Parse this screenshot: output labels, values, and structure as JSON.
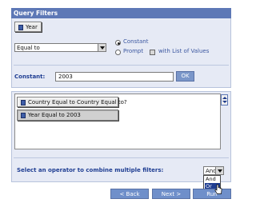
{
  "query_filters": {
    "title": "Query Filters",
    "field_button": "Year",
    "operator_select": "Equal to",
    "value_source": {
      "constant_label": "Constant",
      "prompt_label": "Prompt",
      "selected": "Constant",
      "list_of_values_label": "with List of Values",
      "list_of_values_checked": false
    },
    "constant": {
      "label": "Constant:",
      "value": "2003",
      "ok_label": "OK"
    }
  },
  "filters": {
    "items": [
      "Country Equal to Country Equal to?",
      "Year Equal to 2003"
    ],
    "selected_index": 1
  },
  "combine": {
    "label": "Select an operator to combine multiple filters:",
    "value": "And",
    "options": [
      "And",
      "Or"
    ],
    "highlighted_option": "Or"
  },
  "navigation": {
    "back": "< Back",
    "next": "Next >",
    "run": "Run"
  },
  "colors": {
    "title_bar": "#5d78b6",
    "panel_bg": "#e6eaf5",
    "button_blue": "#6f8fca",
    "label_blue": "#1e3d92"
  }
}
